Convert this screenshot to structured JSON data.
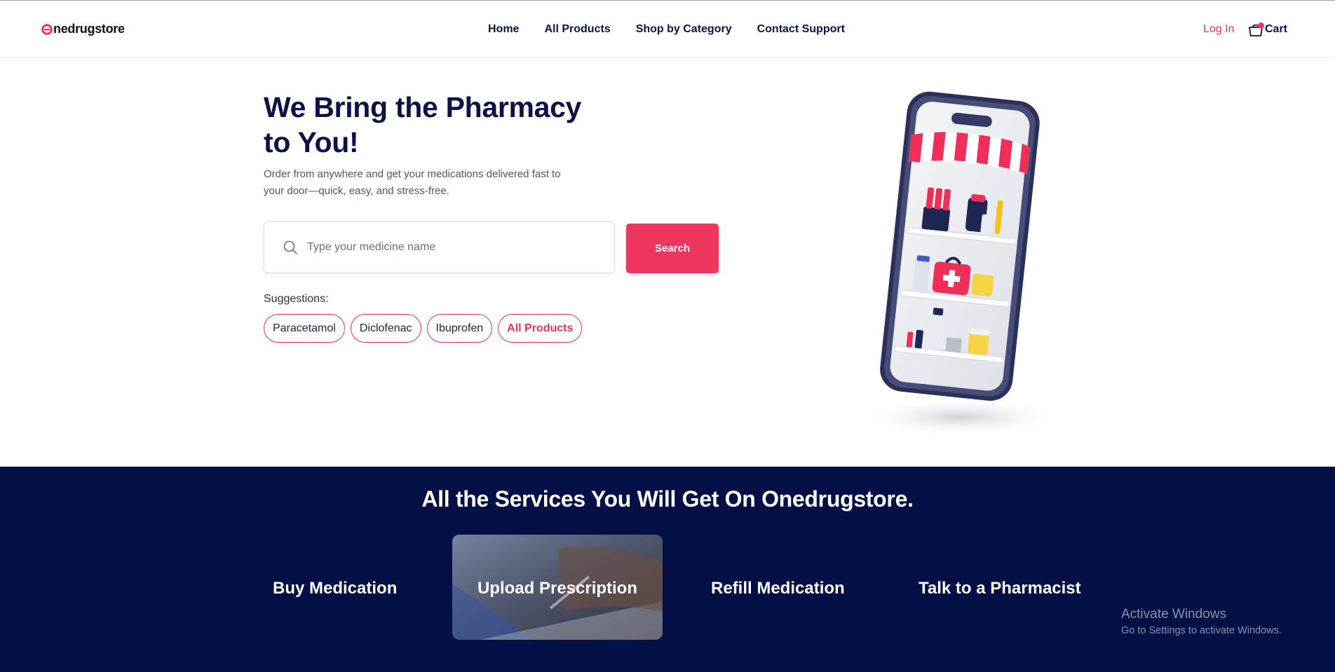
{
  "header": {
    "logo_text": "nedrugstore",
    "nav": [
      "Home",
      "All Products",
      "Shop by Category",
      "Contact Support"
    ],
    "login": "Log In",
    "cart": "Cart"
  },
  "hero": {
    "title": "We Bring the Pharmacy to You!",
    "subtitle": "Order from anywhere and get your medications delivered fast to your door—quick, easy, and stress-free.",
    "search_placeholder": "Type your medicine name",
    "search_button": "Search",
    "suggestions_label": "Suggestions:",
    "suggestions": [
      "Paracetamol",
      "Diclofenac",
      "Ibuprofen",
      "All Products"
    ]
  },
  "services": {
    "title": "All the Services You Will Get On Onedrugstore.",
    "items": [
      "Buy Medication",
      "Upload Prescription",
      "Refill Medication",
      "Talk to a Pharmacist"
    ]
  },
  "os_watermark": {
    "title": "Activate Windows",
    "subtitle": "Go to Settings to activate Windows."
  },
  "colors": {
    "navy": "#0b1245",
    "band": "#030f45",
    "accent": "#f0355f"
  }
}
